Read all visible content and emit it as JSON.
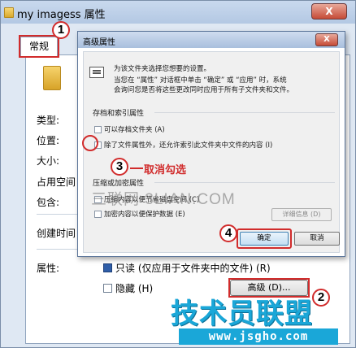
{
  "back_window": {
    "title": "my imagess 属性",
    "close_label": "X",
    "tab_general": "常规",
    "labels": {
      "type": "类型:",
      "location": "位置:",
      "size": "大小:",
      "size_on_disk": "占用空间",
      "contains": "包含:",
      "created": "创建时间",
      "attributes": "属性:"
    },
    "attr_readonly": "只读 (仅应用于文件夹中的文件) (R)",
    "attr_hidden": "隐藏 (H)",
    "advanced_button": "高级 (D)..."
  },
  "dialog": {
    "title": "高级属性",
    "close_label": "X",
    "intro_line1": "为该文件夹选择您想要的设置。",
    "intro_line2": "当您在 “属性” 对话框中单击 “确定” 或 “应用” 时，系统",
    "intro_line3": "会询问您是否将这些更改同时应用于所有子文件夹和文件。",
    "group_archive": "存档和索引属性",
    "check_archive": "可以存档文件夹 (A)",
    "check_index": "除了文件属性外，还允许索引此文件夹中文件的内容 (I)",
    "group_compress": "压缩或加密属性",
    "check_compress": "压缩内容以便节省磁盘空间 (C)",
    "check_encrypt": "加密内容以便保护数据 (E)",
    "details_button": "详细信息 (D)",
    "ok_button": "确定",
    "cancel_button": "取消"
  },
  "annotations": {
    "step1": "1",
    "step2": "2",
    "step3": "3",
    "step4": "4",
    "uncheck_note": "取消勾选"
  },
  "watermark": {
    "site_text": "三联网 3LIAN.COM",
    "brand": "技术员联盟",
    "url": "www.jsgho.com"
  },
  "colors": {
    "highlight_red": "#d12c2c",
    "brand_blue": "#1aa7d8"
  }
}
